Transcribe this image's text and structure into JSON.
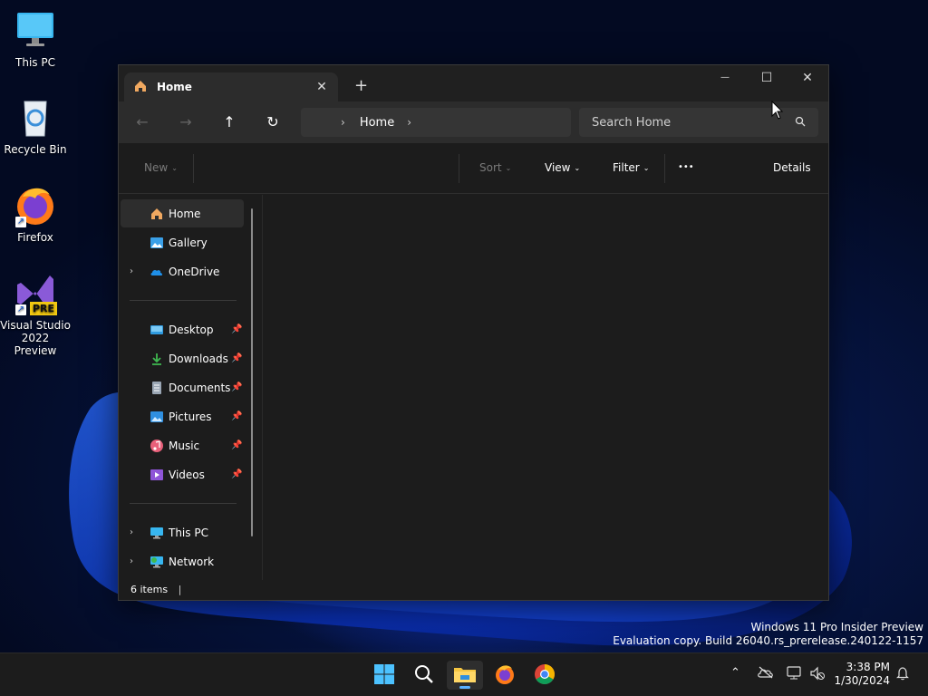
{
  "desktop": {
    "icons": [
      {
        "label": "This PC"
      },
      {
        "label": "Recycle Bin"
      },
      {
        "label": "Firefox"
      },
      {
        "label": "Visual Studio 2022 Preview",
        "badge": "PRE"
      }
    ]
  },
  "explorer": {
    "tab": {
      "label": "Home"
    },
    "new_tab_glyph": "+",
    "window_controls": {
      "minimize": "—",
      "maximize": "☐",
      "close": "✕"
    },
    "address": {
      "crumb": "Home"
    },
    "search": {
      "placeholder": "Search Home"
    },
    "commands": {
      "new": "New",
      "sort": "Sort",
      "view": "View",
      "filter": "Filter",
      "more": "•••",
      "details": "Details"
    },
    "sidebar": {
      "top": [
        {
          "label": "Home",
          "icon": "home-icon",
          "selected": true
        },
        {
          "label": "Gallery",
          "icon": "gallery-icon"
        },
        {
          "label": "OneDrive",
          "icon": "onedrive-icon",
          "expandable": true
        }
      ],
      "quick_access": [
        {
          "label": "Desktop",
          "icon": "desktop-folder-icon"
        },
        {
          "label": "Downloads",
          "icon": "downloads-icon"
        },
        {
          "label": "Documents",
          "icon": "documents-icon"
        },
        {
          "label": "Pictures",
          "icon": "pictures-icon"
        },
        {
          "label": "Music",
          "icon": "music-icon"
        },
        {
          "label": "Videos",
          "icon": "videos-icon"
        }
      ],
      "bottom": [
        {
          "label": "This PC",
          "icon": "this-pc-icon"
        },
        {
          "label": "Network",
          "icon": "network-icon"
        }
      ]
    },
    "status": {
      "item_count": "6 items"
    }
  },
  "watermark": {
    "line1": "Windows 11 Pro Insider Preview",
    "line2": "Evaluation copy. Build 26040.rs_prerelease.240122-1157"
  },
  "taskbar": {
    "clock": {
      "time": "3:38 PM",
      "date": "1/30/2024"
    }
  },
  "colors": {
    "accent": "#5ab0ff",
    "window_bg": "#1c1c1c",
    "folder_yellow": "#f5c542"
  }
}
